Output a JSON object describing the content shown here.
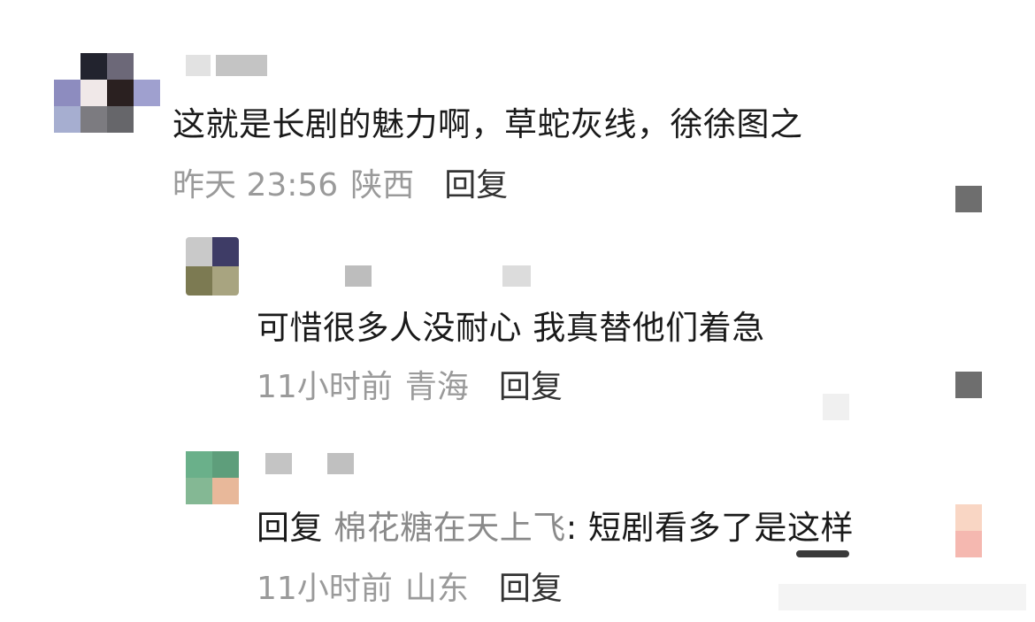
{
  "main_comment": {
    "text": "这就是长剧的魅力啊，草蛇灰线，徐徐图之",
    "time": "昨天 23:56",
    "location": "陕西",
    "reply_label": "回复",
    "avatar_colors": [
      "#ffffff",
      "#22232e",
      "#6c6878",
      "#ffffff",
      "#8d8cbf",
      "#f0e8e8",
      "#2a2020",
      "#9fa0cf",
      "#a6aed0",
      "#7c7b80",
      "#66666a",
      "#ffffff"
    ]
  },
  "replies": [
    {
      "text": "可惜很多人没耐心 我真替他们着急",
      "time": "11小时前",
      "location": "青海",
      "reply_label": "回复",
      "avatar_colors": [
        "#c9c9c9",
        "#3e3c66",
        "#7c7a52",
        "#a8a480"
      ]
    },
    {
      "reply_prefix": "回复",
      "reply_target": "棉花糖在天上飞",
      "text": ": 短剧看多了是这样",
      "time": "11小时前",
      "location": "山东",
      "reply_label": "回复",
      "avatar_colors": [
        "#6ab08a",
        "#5e9e7b",
        "#84b894",
        "#e8b89a"
      ]
    }
  ],
  "colors": {
    "side_square": "#6e6e6e",
    "side_pink_top": "#f9d6c4",
    "side_pink_bottom": "#f5b8b0"
  }
}
